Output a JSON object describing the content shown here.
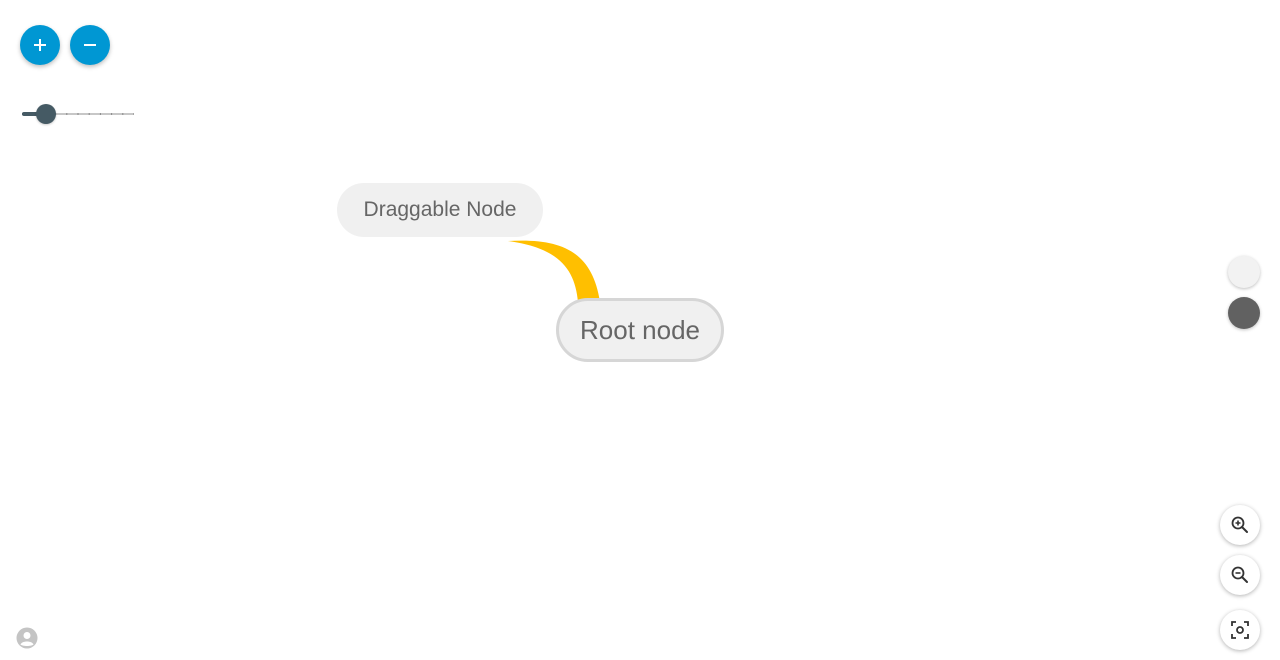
{
  "toolbar": {
    "add_icon": "plus-icon",
    "remove_icon": "minus-icon"
  },
  "slider": {
    "value_fraction": 0.2,
    "tick_count": 11
  },
  "nodes": {
    "draggable": {
      "label": "Draggable Node"
    },
    "root": {
      "label": "Root node"
    }
  },
  "connector": {
    "color": "#FFBF00"
  },
  "swatches": [
    {
      "name": "light",
      "color": "#F2F2F2"
    },
    {
      "name": "dark",
      "color": "#616161"
    }
  ],
  "zoom_controls": {
    "zoom_in_icon": "zoom-in-icon",
    "zoom_out_icon": "zoom-out-icon",
    "fit_icon": "fit-view-icon"
  },
  "colors": {
    "accent": "#0097D3",
    "slider": "#455A64",
    "node_text": "#666666"
  }
}
